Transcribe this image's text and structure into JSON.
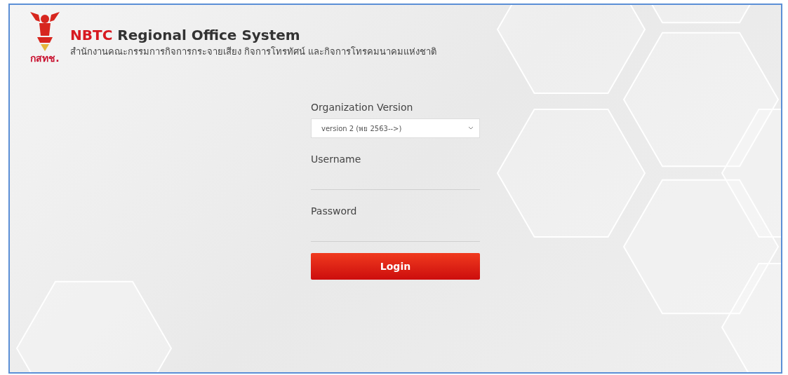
{
  "header": {
    "logo_text": "กสทช.",
    "title_brand": "NBTC",
    "title_rest": " Regional Office System",
    "subtitle": "สำนักงานคณะกรรมการกิจการกระจายเสียง กิจการโทรทัศน์ และกิจการโทรคมนาคมแห่งชาติ"
  },
  "form": {
    "version_label": "Organization Version",
    "version_value": "version 2 (พย 2563-->)",
    "username_label": "Username",
    "password_label": "Password",
    "login_button": "Login"
  }
}
